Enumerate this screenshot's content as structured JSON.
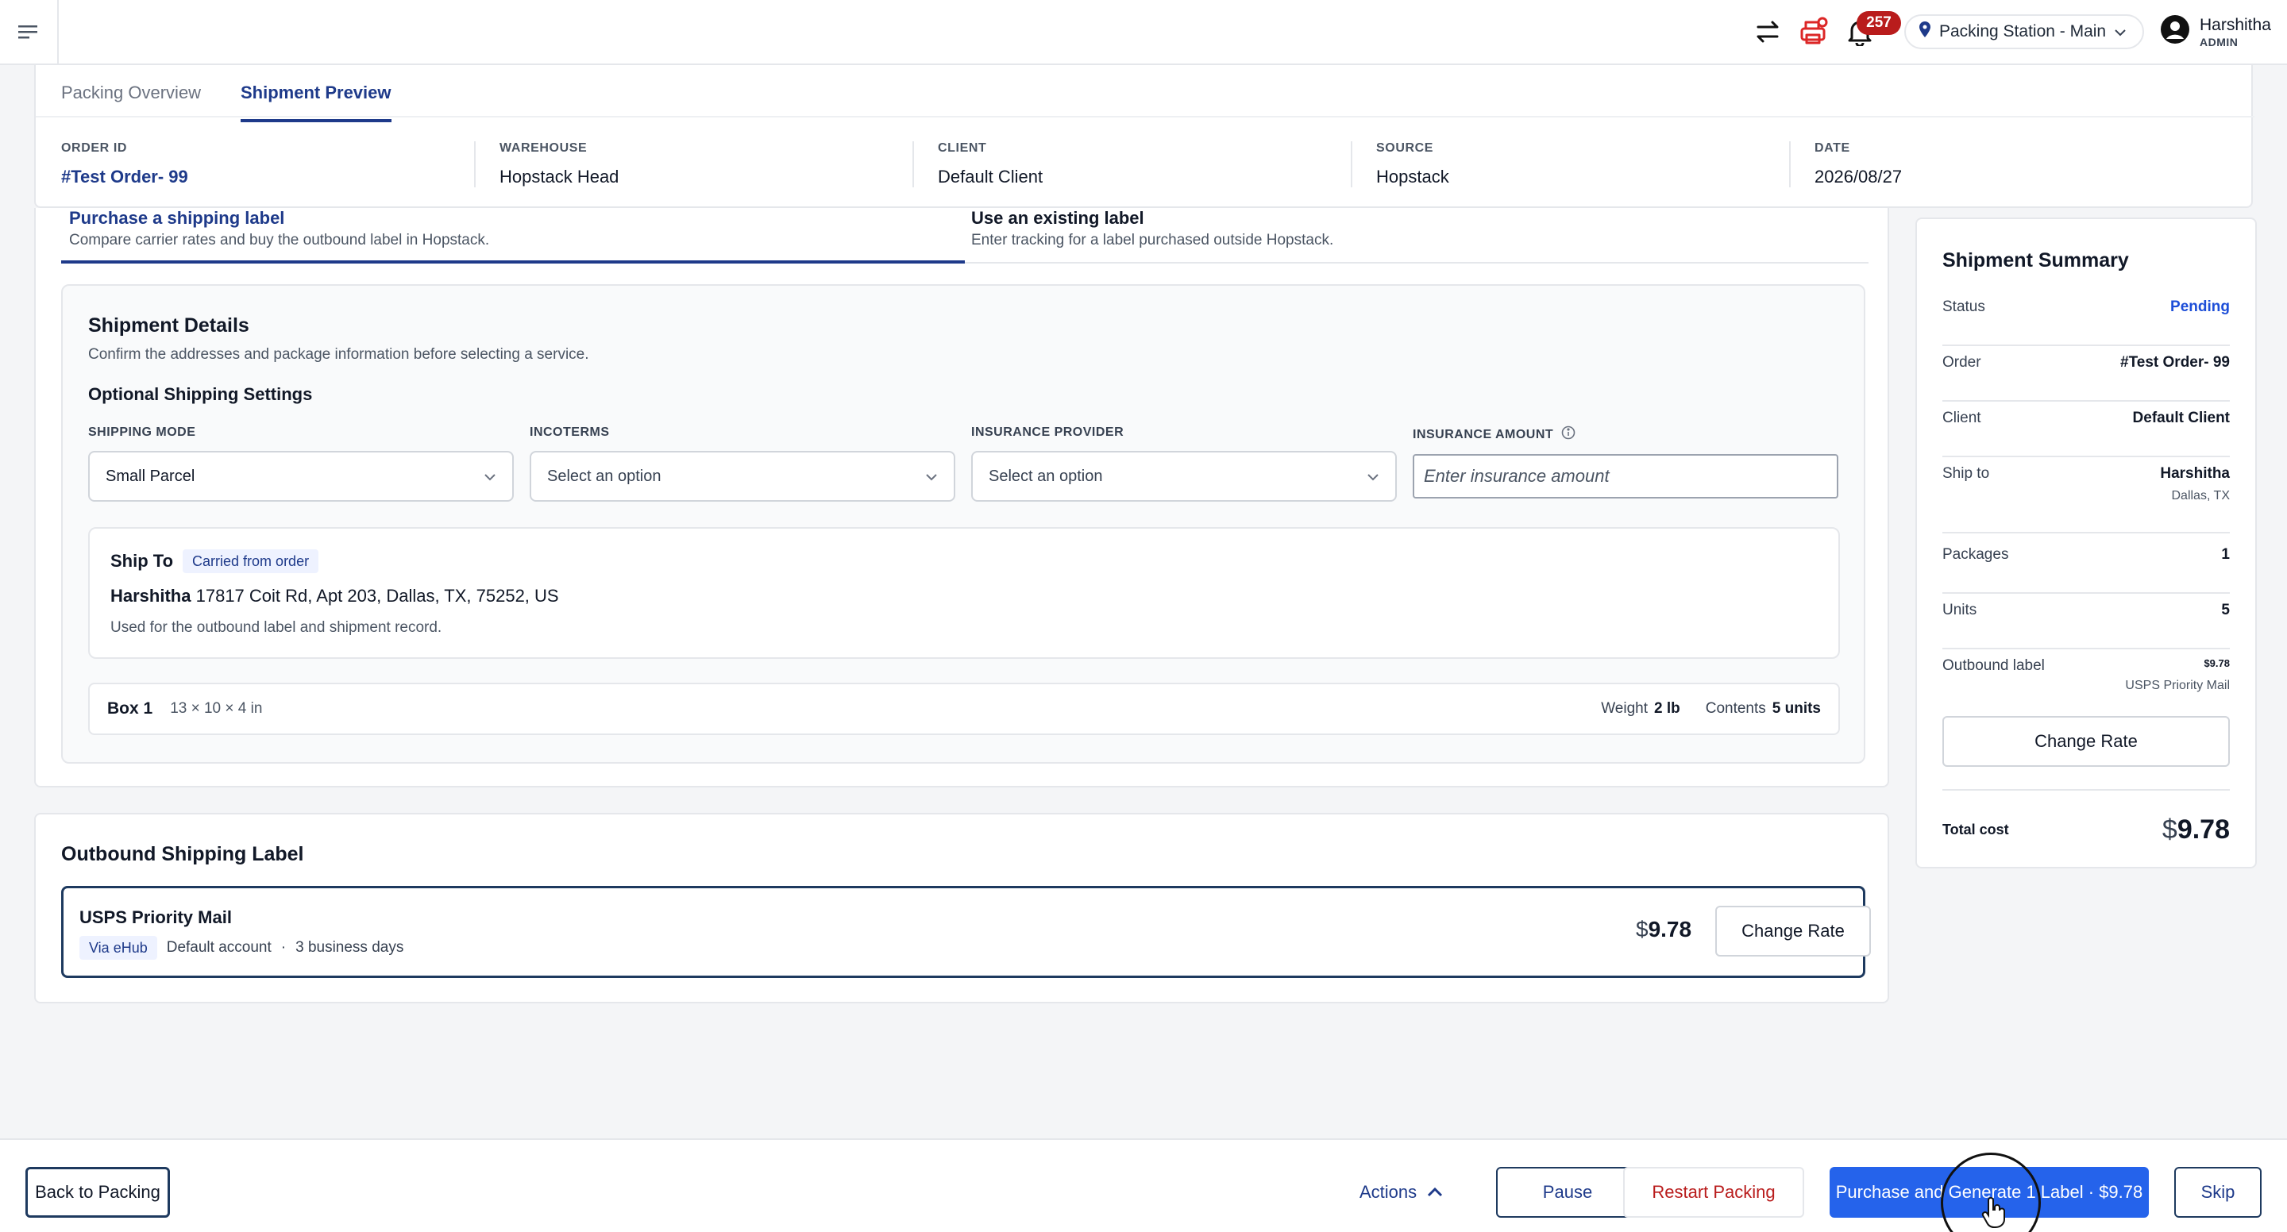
{
  "header": {
    "notifications_count": "257",
    "station": "Packing Station - Main",
    "user_name": "Harshitha",
    "user_role": "ADMIN"
  },
  "tabs": [
    {
      "label": "Packing Overview",
      "active": false
    },
    {
      "label": "Shipment Preview",
      "active": true
    }
  ],
  "order_meta": {
    "order_id_label": "ORDER ID",
    "order_id": "#Test Order- 99",
    "warehouse_label": "WAREHOUSE",
    "warehouse": "Hopstack Head",
    "client_label": "CLIENT",
    "client": "Default Client",
    "source_label": "SOURCE",
    "source": "Hopstack",
    "date_label": "DATE",
    "date": "2026/08/27"
  },
  "label_options": {
    "purchase_title": "Purchase a shipping label",
    "purchase_sub": "Compare carrier rates and buy the outbound label in Hopstack.",
    "existing_title": "Use an existing label",
    "existing_sub": "Enter tracking for a label purchased outside Hopstack."
  },
  "shipment_details": {
    "title": "Shipment Details",
    "subtitle": "Confirm the addresses and package information before selecting a service.",
    "optional_title": "Optional Shipping Settings",
    "shipping_mode_label": "SHIPPING MODE",
    "shipping_mode_value": "Small Parcel",
    "incoterms_label": "INCOTERMS",
    "incoterms_value": "Select an option",
    "insurance_provider_label": "INSURANCE PROVIDER",
    "insurance_provider_value": "Select an option",
    "insurance_amount_label": "INSURANCE AMOUNT",
    "insurance_amount_placeholder": "Enter insurance amount",
    "ship_to_title": "Ship To",
    "ship_to_pill": "Carried from order",
    "ship_to_name": "Harshitha",
    "ship_to_address": "17817 Coit Rd, Apt 203, Dallas, TX, 75252, US",
    "ship_to_note": "Used for the outbound label and shipment record.",
    "box_name": "Box 1",
    "box_dims": "13 × 10 × 4 in",
    "weight_label": "Weight",
    "weight_value": "2 lb",
    "contents_label": "Contents",
    "contents_value": "5 units"
  },
  "outbound": {
    "title": "Outbound Shipping Label",
    "carrier": "USPS Priority Mail",
    "via": "Via eHub",
    "account": "Default account",
    "separator": "·",
    "transit": "3 business days",
    "currency": "$",
    "price": "9.78",
    "change_rate": "Change Rate"
  },
  "summary": {
    "title": "Shipment Summary",
    "status_label": "Status",
    "status_value": "Pending",
    "order_label": "Order",
    "order_value": "#Test Order- 99",
    "client_label": "Client",
    "client_value": "Default Client",
    "ship_to_label": "Ship to",
    "ship_to_value": "Harshitha",
    "ship_to_city": "Dallas, TX",
    "packages_label": "Packages",
    "packages_value": "1",
    "units_label": "Units",
    "units_value": "5",
    "outbound_label": "Outbound label",
    "outbound_value": "$9.78",
    "outbound_service": "USPS Priority Mail",
    "change_rate": "Change Rate",
    "total_label": "Total cost",
    "total_currency": "$",
    "total_value": "9.78"
  },
  "footer": {
    "back": "Back to Packing",
    "actions": "Actions",
    "pause": "Pause",
    "restart": "Restart Packing",
    "purchase": "Purchase and Generate 1 Label · $9.78",
    "skip": "Skip"
  },
  "colors": {
    "accent": "#1e3a8a",
    "primary_button": "#2563eb",
    "danger": "#b91c1c",
    "status_pending": "#1d4ed8"
  }
}
